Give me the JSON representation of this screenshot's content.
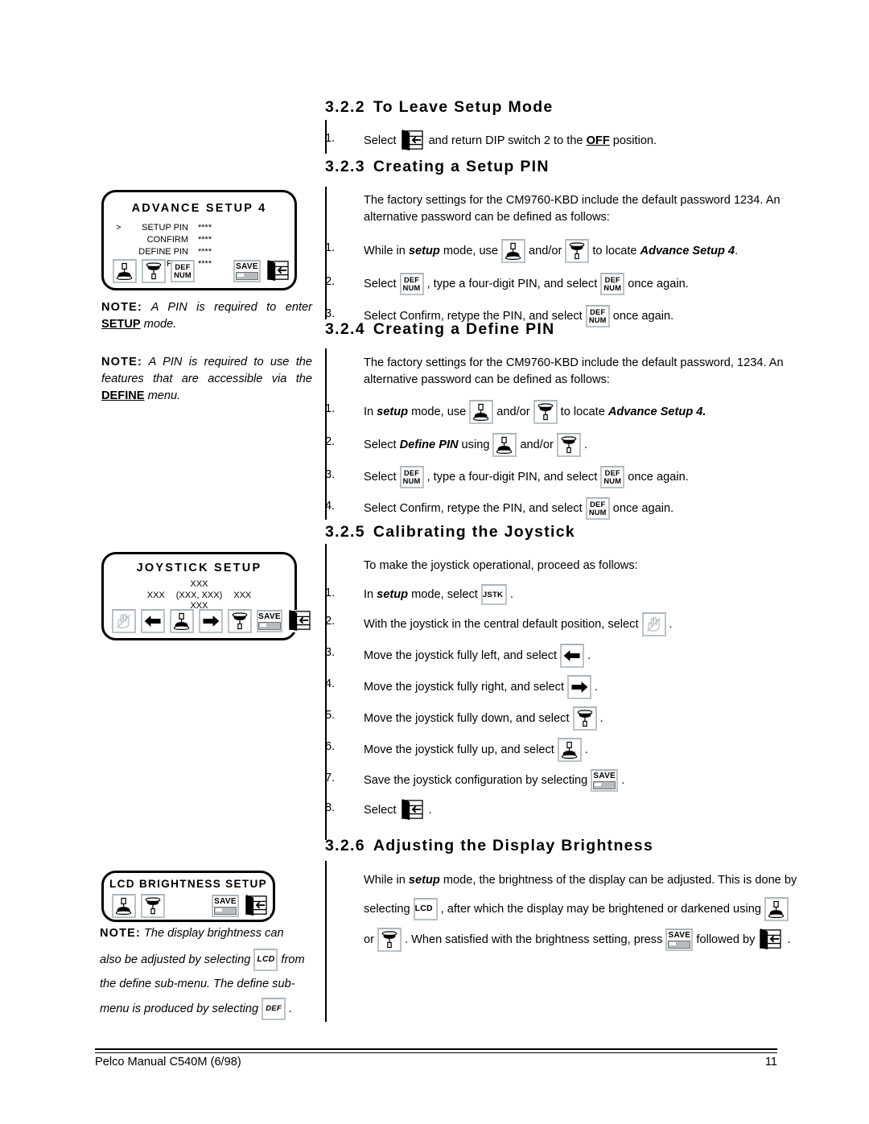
{
  "footer": {
    "left": "Pelco Manual C540M (6/98)",
    "page_number": "11"
  },
  "sections": {
    "leave_setup": {
      "number": "3.2.2",
      "title": "To Leave Setup Mode",
      "steps": [
        {
          "no": "1.",
          "pre": "Select",
          "icon": "exit-icon",
          "mid": "and return DIP switch 2 to the",
          "emph": "OFF",
          "post": "position."
        }
      ]
    },
    "setup_pin": {
      "number": "3.2.3",
      "title": "Creating a Setup PIN",
      "intro_a": "The factory settings for the CM9760-KBD include the default password 1234. An",
      "intro_b": "alternative password can be defined as follows:",
      "step1": {
        "no": "1.",
        "a": "While in",
        "setup": "setup",
        "b": "mode, use",
        "andor": "and/or",
        "c": "to locate",
        "target": "Advance Setup 4",
        "end": "."
      },
      "step2": {
        "no": "2.",
        "a": "Select",
        "b": ", type a four-digit PIN, and select",
        "c": "once again."
      },
      "step3": {
        "no": "3.",
        "a": "Select Confirm, retype the PIN, and select",
        "b": "once again."
      }
    },
    "define_pin": {
      "number": "3.2.4",
      "title": "Creating a Define PIN",
      "intro_a": "The factory settings for the CM9760-KBD include the default password, 1234. An",
      "intro_b": "alternative password can be defined as follows:",
      "step1": {
        "no": "1.",
        "a": "In",
        "setup": "setup",
        "b": "mode, use",
        "andor": "and/or",
        "c": "to locate",
        "target": "Advance Setup 4."
      },
      "step2": {
        "no": "2.",
        "a": "Select",
        "target": "Define PIN",
        "b": "using",
        "andor": "and/or",
        "end": "."
      },
      "step3": {
        "no": "3.",
        "a": "Select",
        "b": ", type a four-digit PIN, and select",
        "c": "once again."
      },
      "step4": {
        "no": "4.",
        "a": "Select Confirm, retype the PIN, and select",
        "b": "once again."
      }
    },
    "joystick": {
      "number": "3.2.5",
      "title": "Calibrating the Joystick",
      "intro": "To make the joystick operational, proceed as follows:",
      "steps": [
        {
          "no": "1.",
          "a": "In",
          "setup": "setup",
          "b": "mode, select",
          "icon": "jstk-key",
          "end": "."
        },
        {
          "no": "2.",
          "a": "With the joystick in the central default position,  select",
          "icon": "hand-icon",
          "end": "."
        },
        {
          "no": "3.",
          "a": "Move the joystick fully left, and select",
          "icon": "arrow-left-icon",
          "end": "."
        },
        {
          "no": "4.",
          "a": "Move the joystick fully right, and select",
          "icon": "arrow-right-icon",
          "end": "."
        },
        {
          "no": "5.",
          "a": "Move the joystick fully down, and select",
          "icon": "joystick-down-icon",
          "end": "."
        },
        {
          "no": "6.",
          "a": "Move the joystick fully up, and select",
          "icon": "joystick-up-icon",
          "end": "."
        },
        {
          "no": "7.",
          "a": "Save the joystick configuration by selecting",
          "icon": "save-key",
          "end": "."
        },
        {
          "no": "8.",
          "a": "Select",
          "icon": "exit-icon",
          "end": "."
        }
      ]
    },
    "brightness": {
      "number": "3.2.6",
      "title": "Adjusting the Display Brightness",
      "line1_a": "While in",
      "line1_setup": "setup",
      "line1_b": "mode, the brightness of the display can be adjusted. This is done by",
      "line2_a": "selecting",
      "line2_b": ", after which the display may be brightened or darkened using",
      "line3_a": "or",
      "line3_b": ". When satisfied with the brightness setting, press",
      "line3_c": "followed by",
      "line3_end": "."
    }
  },
  "lcd_panels": {
    "advance_setup": {
      "title": "ADVANCE SETUP 4",
      "rows": [
        {
          "cursor": ">",
          "label": "SETUP PIN",
          "value": "****"
        },
        {
          "cursor": "",
          "label": "CONFIRM",
          "value": "****"
        },
        {
          "cursor": "",
          "label": "DEFINE PIN",
          "value": "****"
        },
        {
          "cursor": "",
          "label": "CONFIRM",
          "value": "****"
        }
      ],
      "icons": [
        "joystick-up-icon",
        "joystick-down-icon",
        "defnum-key",
        "save-key",
        "exit-icon"
      ]
    },
    "joystick_setup": {
      "title": "JOYSTICK SETUP",
      "readout": {
        "top": "XXX",
        "left": "XXX",
        "center": "(XXX, XXX)",
        "right": "XXX",
        "bottom": "XXX"
      },
      "icons": [
        "hand-icon",
        "arrow-left-icon",
        "joystick-up-icon",
        "arrow-right-icon",
        "joystick-down-icon",
        "save-key",
        "exit-icon"
      ]
    },
    "lcd_brightness": {
      "title": "LCD BRIGHTNESS SETUP",
      "icons": [
        "joystick-up-icon",
        "joystick-down-icon",
        "save-key",
        "exit-icon"
      ]
    }
  },
  "notes": {
    "note1": {
      "label": "NOTE:",
      "text_a": "A PIN is required to enter",
      "keyword": "SETUP",
      "text_b": "mode."
    },
    "note2": {
      "label": "NOTE:",
      "text_a": "A PIN is required to use the features that are accessible via the",
      "keyword": "DEFINE",
      "text_b": "menu."
    },
    "note3": {
      "label": "NOTE:",
      "text_a": "The display brightness can",
      "text_b": "also be adjusted by selecting",
      "text_c": "from",
      "text_d": "the define sub-menu. The define sub-",
      "text_e": "menu is produced by selecting",
      "text_f": "."
    }
  },
  "keys": {
    "defnum_top": "DEF",
    "defnum_bottom": "NUM",
    "save": "SAVE",
    "jstk": "JSTK",
    "lcd": "LCD",
    "def": "DEF"
  }
}
